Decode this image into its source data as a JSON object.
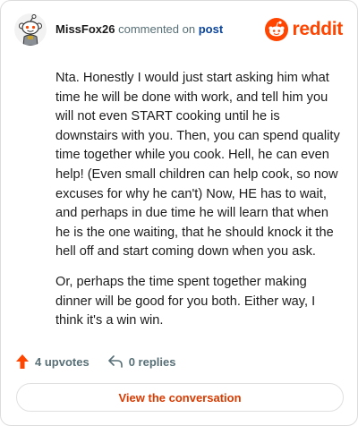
{
  "header": {
    "username": "MissFox26",
    "commented_text": " commented on ",
    "post_link": "post",
    "brand": "reddit"
  },
  "comment": {
    "paragraphs": [
      "Nta. Honestly I would just start asking him what time he will be done with work, and tell him you will not even START cooking until he is downstairs with you. Then, you can spend quality time together while you cook. Hell, he can even help! (Even small children can help cook, so now excuses for why he can't) Now, HE has to wait, and perhaps in due time he will learn that when he is the one waiting, that he should knock it the hell off and start coming down when you ask.",
      "Or, perhaps the time spent together making dinner will be good for you both. Either way, I think it's a win win."
    ]
  },
  "actions": {
    "upvotes": "4 upvotes",
    "replies": "0 replies"
  },
  "cta": {
    "label": "View the conversation"
  },
  "colors": {
    "brand": "#ff4500",
    "link": "#0a449b",
    "cta_text": "#d93a00",
    "muted": "#576f76"
  },
  "icons": {
    "avatar": "snoo-avatar-icon",
    "brand": "reddit-logo-icon",
    "upvote": "upvote-arrow-icon",
    "reply": "reply-arrow-icon"
  }
}
